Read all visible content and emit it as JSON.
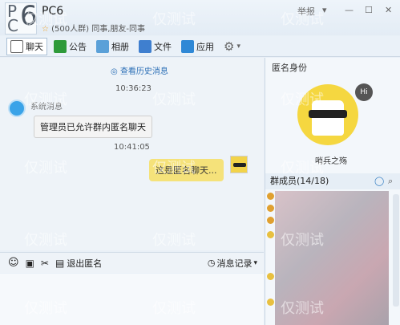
{
  "title": {
    "logo_p": "P",
    "logo_c": "C",
    "logo_six": "6",
    "group_name": "PC6",
    "group_sub": "(500人群) 同事,朋友-同事",
    "report": "举报"
  },
  "toolbar": {
    "items": [
      {
        "label": "聊天",
        "icon": "chat-icon"
      },
      {
        "label": "公告",
        "icon": "flag-icon"
      },
      {
        "label": "相册",
        "icon": "photo-icon"
      },
      {
        "label": "文件",
        "icon": "folder-icon"
      },
      {
        "label": "应用",
        "icon": "apps-icon"
      }
    ],
    "settings_icon": "gear-icon"
  },
  "chat": {
    "history_link": "查看历史消息",
    "time1": "10:36:23",
    "sender": "系统消息",
    "system_message": "管理员已允许群内匿名聊天",
    "time2": "10:41:05",
    "my_message": "这是匿名聊天..."
  },
  "input_bar": {
    "exit_anon": "退出匿名",
    "history": "消息记录"
  },
  "right_panel": {
    "anon_title": "匿名身份",
    "hi_badge": "Hi",
    "anon_name": "哨兵之殇",
    "members_label": "群成员(14/18)"
  },
  "watermark": "仅测试"
}
